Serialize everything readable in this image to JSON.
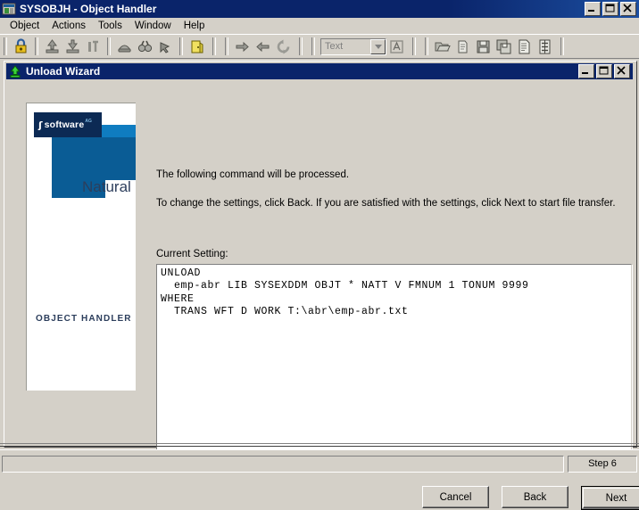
{
  "app": {
    "title": "SYSOBJH - Object Handler",
    "icon": "app-window-icon",
    "window_buttons": [
      "minimize",
      "maximize",
      "close"
    ]
  },
  "menubar": {
    "items": [
      {
        "label": "Object"
      },
      {
        "label": "Actions"
      },
      {
        "label": "Tools"
      },
      {
        "label": "Window"
      },
      {
        "label": "Help"
      }
    ]
  },
  "toolbar": {
    "groups": [
      {
        "icons": [
          "padlock-icon"
        ]
      },
      {
        "icons": [
          "unload-icon",
          "load-icon",
          "scan-icon"
        ]
      },
      {
        "icons": [
          "browse-icon",
          "find-icon",
          "select-icon"
        ]
      },
      {
        "icons": [
          "exit-door-icon"
        ]
      },
      {
        "icons": [
          "forward-arrow-icon",
          "back-arrow-icon",
          "refresh-icon"
        ]
      }
    ],
    "combo": {
      "value": "",
      "placeholder": "Text"
    },
    "combo_side_icon": "edit-text-icon",
    "file_icons": [
      "open-folder-icon",
      "new-document-icon",
      "save-icon",
      "save-as-icon",
      "report-icon",
      "list-icon"
    ]
  },
  "wizard": {
    "title": "Unload Wizard",
    "icon": "unload-arrow-icon",
    "window_buttons": [
      "minimize",
      "maximize",
      "close"
    ],
    "banner": {
      "brand_symbol": "ʃ",
      "brand_name": "software",
      "brand_suffix": "AG",
      "product": "Natural",
      "module": "OBJECT HANDLER",
      "colors": {
        "dark_navy": "#0c2a54",
        "mid_blue": "#0a5c95",
        "light_blue": "#0f7cc0",
        "text_navy": "#2c3e5c"
      }
    },
    "intro_line1": "The following command will be processed.",
    "intro_line2": "To change the settings, click Back. If you are satisfied with the settings, click Next to start file transfer.",
    "current_setting_label": "Current Setting:",
    "current_setting_text": "UNLOAD\n  emp-abr LIB SYSEXDDM OBJT * NATT V FMNUM 1 TONUM 9999\nWHERE\n  TRANS WFT D WORK T:\\abr\\emp-abr.txt",
    "buttons": {
      "cancel": "Cancel",
      "back": "Back",
      "next": "Next",
      "default_button": "next"
    }
  },
  "statusbar": {
    "message": "",
    "step": "Step 6"
  }
}
